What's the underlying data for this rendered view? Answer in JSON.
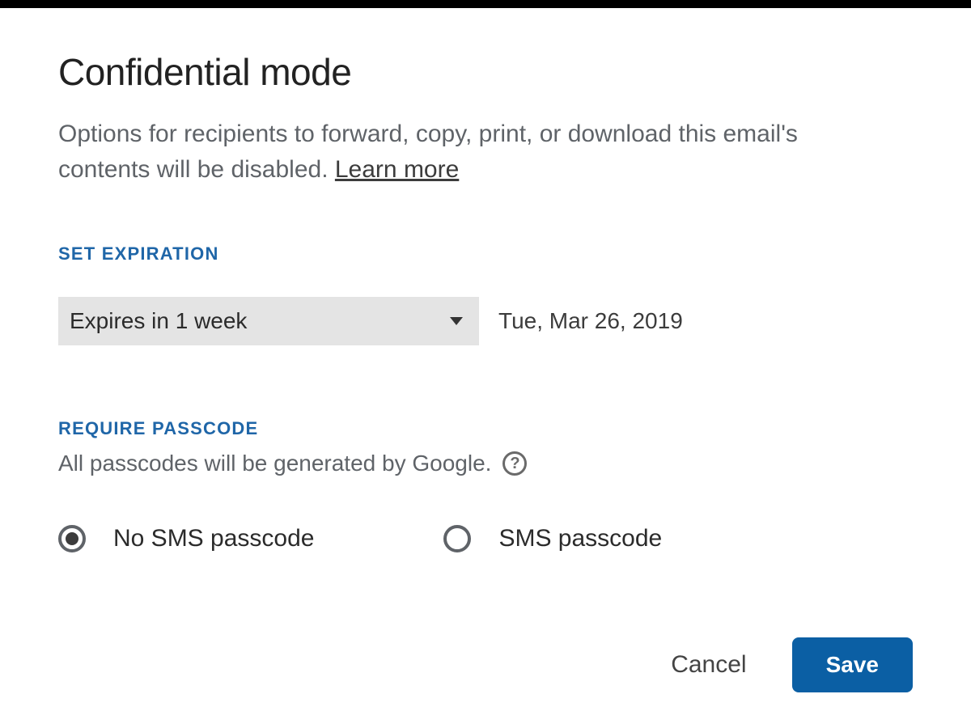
{
  "dialog": {
    "title": "Confidential mode",
    "description": "Options for recipients to forward, copy, print, or download this email's contents will be disabled. ",
    "learn_more": "Learn more"
  },
  "expiration": {
    "section_label": "SET EXPIRATION",
    "dropdown_value": "Expires in 1 week",
    "date": "Tue, Mar 26, 2019"
  },
  "passcode": {
    "section_label": "REQUIRE PASSCODE",
    "note": "All passcodes will be generated by Google.",
    "help_glyph": "?",
    "options": {
      "no_sms": "No SMS passcode",
      "sms": "SMS passcode"
    },
    "selected": "no_sms"
  },
  "buttons": {
    "cancel": "Cancel",
    "save": "Save"
  }
}
